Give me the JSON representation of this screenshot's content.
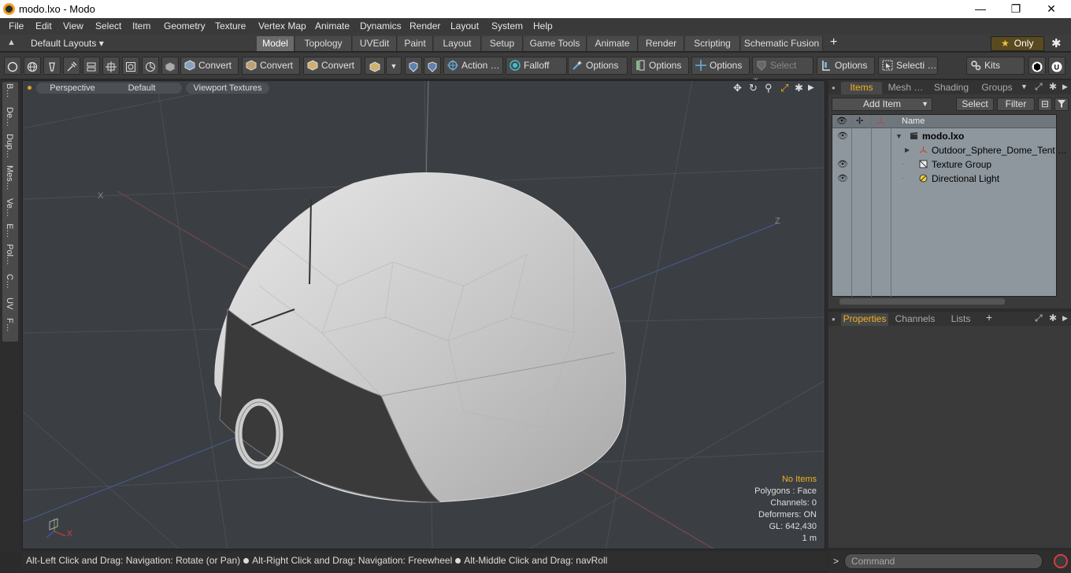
{
  "window": {
    "title": "modo.lxo - Modo",
    "minimize": "—",
    "maximize": "❐",
    "close": "✕"
  },
  "menu": [
    "File",
    "Edit",
    "View",
    "Select",
    "Item",
    "Geometry",
    "Texture",
    "Vertex Map",
    "Animate",
    "Dynamics",
    "Render",
    "Layout",
    "System",
    "Help"
  ],
  "layouts": {
    "dropdown": "Default Layouts ▾",
    "tabs": [
      "Model",
      "Topology",
      "UVEdit",
      "Paint",
      "Layout",
      "Setup",
      "Game Tools",
      "Animate",
      "Render",
      "Scripting",
      "Schematic Fusion"
    ],
    "active": "Model",
    "plus": "+",
    "only": "Only",
    "star": "★",
    "gear": "✱"
  },
  "toolbar": {
    "convert1": "Convert",
    "convert2": "Convert",
    "convert3": "Convert",
    "action": "Action …",
    "falloff": "Falloff",
    "options1": "Options",
    "options2": "Options",
    "options3": "Options",
    "select_t": "Select T…",
    "options4": "Options",
    "selecti": "Selecti …",
    "kits": "Kits"
  },
  "left_tabs": [
    "B…",
    "De…",
    "Dup…",
    "Mes…",
    "Ve…",
    "E…",
    "Pol…",
    "C…",
    "UV",
    "F…"
  ],
  "viewport": {
    "perspective": "Perspective",
    "default": "Default",
    "textures": "Viewport Textures",
    "stats": {
      "no_items": "No Items",
      "polygons": "Polygons : Face",
      "channels": "Channels: 0",
      "deformers": "Deformers: ON",
      "gl": "GL: 642,430",
      "scale": "1 m"
    },
    "axis_x": "X",
    "axis_z": "Z",
    "axis_x_corner": "X"
  },
  "status": {
    "part1": "Alt-Left Click and Drag: Navigation: Rotate (or Pan)",
    "part2": "Alt-Right Click and Drag: Navigation: Freewheel",
    "part3": "Alt-Middle Click and Drag: navRoll"
  },
  "items_panel": {
    "tabs": [
      "Items",
      "Mesh …",
      "Shading",
      "Groups"
    ],
    "active": "Items",
    "add_item": "Add Item",
    "select": "Select",
    "filter": "Filter",
    "column_name": "Name",
    "tree": [
      {
        "label": "modo.lxo",
        "bold": true
      },
      {
        "label": "Outdoor_Sphere_Dome_Tent …"
      },
      {
        "label": "Texture Group"
      },
      {
        "label": "Directional Light"
      }
    ]
  },
  "props_panel": {
    "tabs": [
      "Properties",
      "Channels",
      "Lists"
    ],
    "active": "Properties",
    "plus": "+"
  },
  "command": {
    "prompt": ">",
    "placeholder": "Command"
  },
  "colors": {
    "accent": "#f0b020",
    "viewport_bg": "#3b3f44",
    "panel_bg": "#3a3a3a",
    "tree_bg": "#8e979e"
  }
}
